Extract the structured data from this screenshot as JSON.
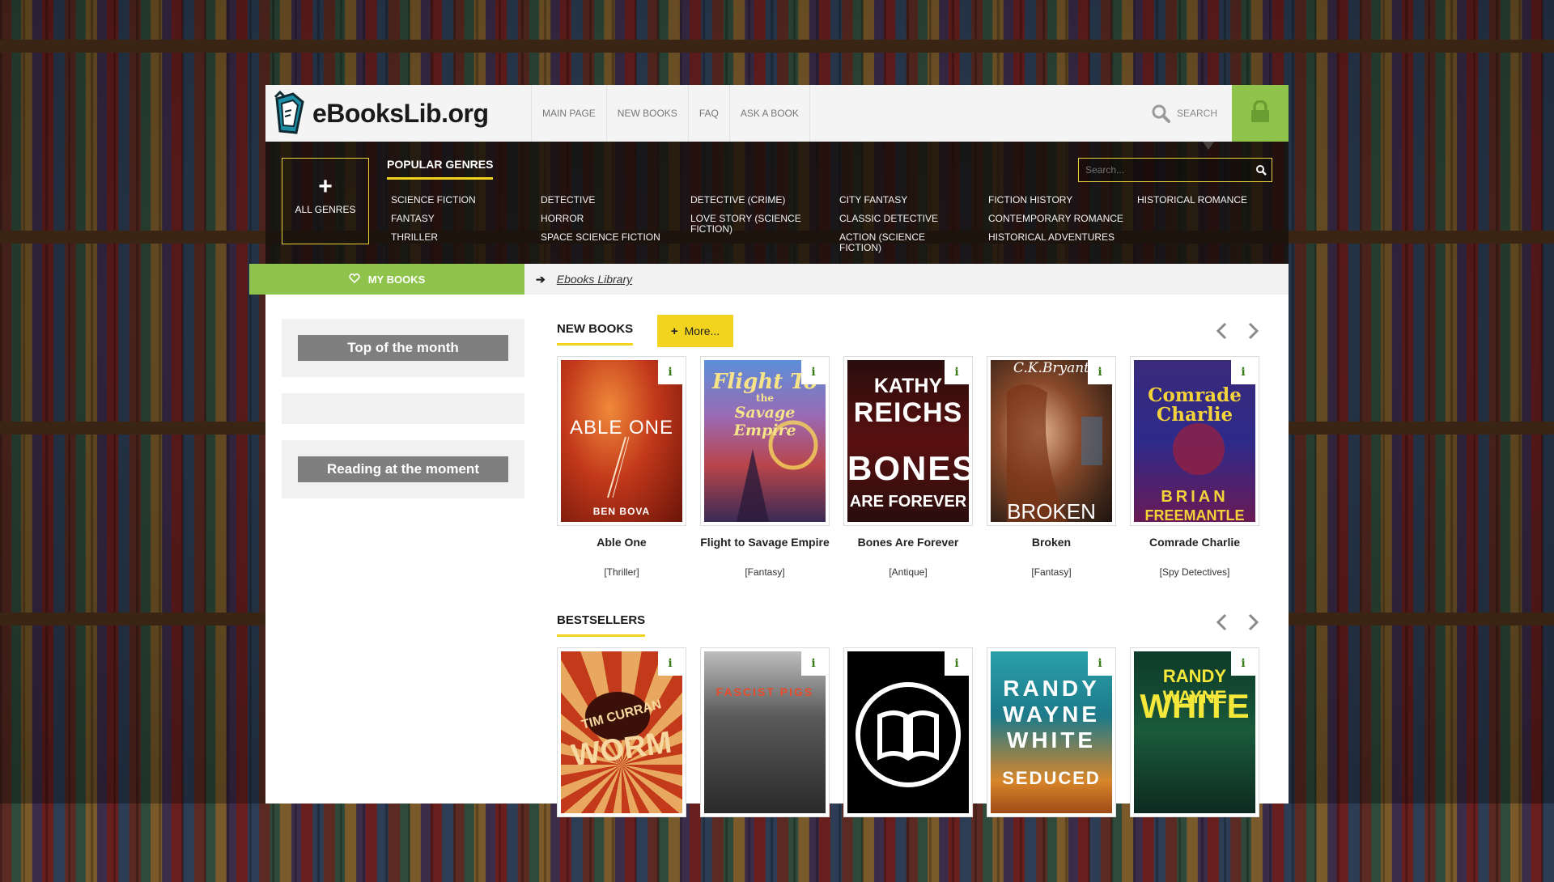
{
  "site": {
    "logo_text": "eBooksLib.org",
    "nav": [
      "MAIN PAGE",
      "NEW BOOKS",
      "FAQ",
      "ASK A BOOK"
    ],
    "search_toggle_label": "SEARCH",
    "search_placeholder": "Search..."
  },
  "genres": {
    "all_genres_label": "ALL GENRES",
    "popular_title": "POPULAR GENRES",
    "items": [
      "SCIENCE FICTION",
      "FANTASY",
      "THRILLER",
      "DETECTIVE",
      "HORROR",
      "SPACE SCIENCE FICTION",
      "DETECTIVE (CRIME)",
      "LOVE STORY (SCIENCE FICTION)",
      "CITY FANTASY",
      "CLASSIC DETECTIVE",
      "ACTION (SCIENCE FICTION)",
      "FICTION HISTORY",
      "CONTEMPORARY ROMANCE",
      "HISTORICAL ADVENTURES",
      "HISTORICAL ROMANCE"
    ]
  },
  "crumbs": {
    "my_books_label": "MY BOOKS",
    "breadcrumb": "Ebooks Library"
  },
  "sidebar": {
    "top_month": "Top of the month",
    "reading_now": "Reading at the moment"
  },
  "new_books": {
    "title": "NEW BOOKS",
    "more_label": "More...",
    "info_glyph": "i",
    "books": [
      {
        "title": "Able One",
        "genre": "[Thriller]",
        "cover_lines": [
          "ABLE ONE",
          "BEN BOVA"
        ]
      },
      {
        "title": "Flight to Savage Empire",
        "genre": "[Fantasy]",
        "cover_lines": [
          "Flight To",
          "the",
          "Savage Empire"
        ]
      },
      {
        "title": "Bones Are Forever",
        "genre": "[Antique]",
        "cover_lines": [
          "KATHY",
          "REICHS",
          "BONES",
          "ARE FOREVER"
        ]
      },
      {
        "title": "Broken",
        "genre": "[Fantasy]",
        "cover_lines": [
          "C.K.Bryant",
          "BROKEN"
        ]
      },
      {
        "title": "Comrade Charlie",
        "genre": "[Spy Detectives]",
        "cover_lines": [
          "Comrade",
          "Charlie",
          "BRIAN",
          "FREEMANTLE"
        ]
      }
    ]
  },
  "bestsellers": {
    "title": "BESTSELLERS",
    "books": [
      {
        "cover_lines": [
          "TIM CURRAN",
          "WORM"
        ]
      },
      {
        "cover_lines": [
          "FASCIST PIGS"
        ]
      },
      {
        "cover_lines": []
      },
      {
        "cover_lines": [
          "RANDY",
          "WAYNE",
          "WHITE",
          "SEDUCED"
        ]
      },
      {
        "cover_lines": [
          "RANDY WAYNE",
          "WHITE"
        ]
      }
    ]
  },
  "colors": {
    "accent_green": "#8fc34c",
    "accent_yellow": "#f2d41e",
    "heading_gray": "#7f7f7f"
  }
}
